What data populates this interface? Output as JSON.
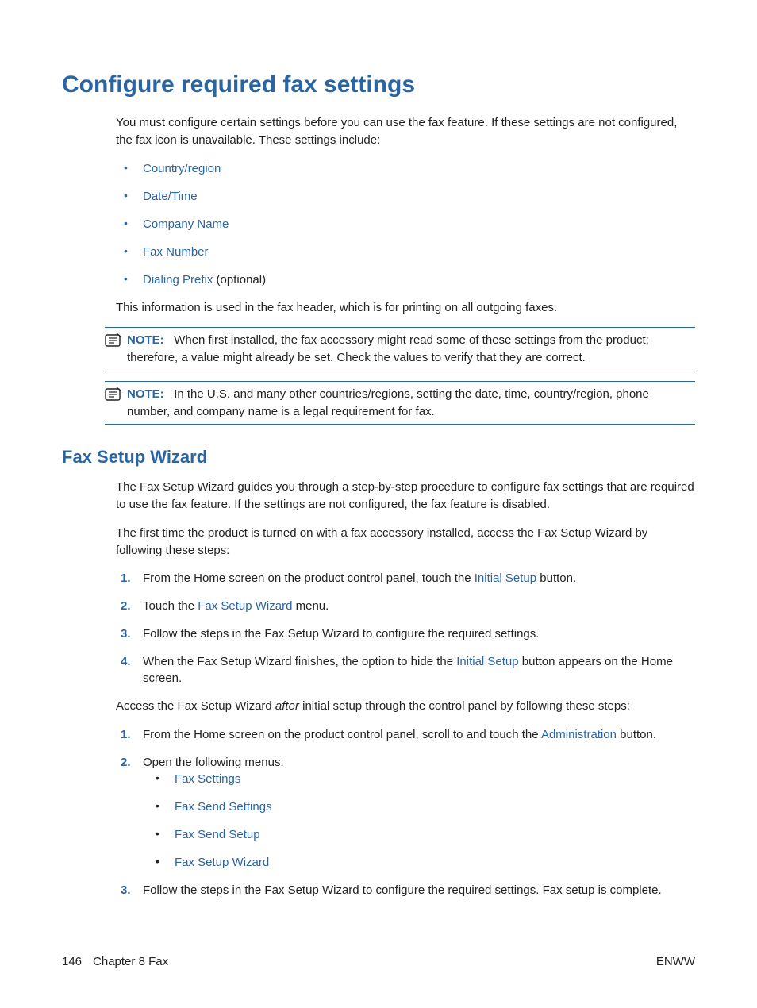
{
  "heading": "Configure required fax settings",
  "intro": "You must configure certain settings before you can use the fax feature. If these settings are not configured, the fax icon is unavailable. These settings include:",
  "settings_list": [
    "Country/region",
    "Date/Time",
    "Company Name",
    "Fax Number"
  ],
  "dialing_prefix": "Dialing Prefix",
  "dialing_suffix": " (optional)",
  "after_list": "This information is used in the fax header, which is for printing on all outgoing faxes.",
  "note1_label": "NOTE:",
  "note1_body": "When first installed, the fax accessory might read some of these settings from the product; therefore, a value might already be set. Check the values to verify that they are correct.",
  "note2_label": "NOTE:",
  "note2_body": "In the U.S. and many other countries/regions, setting the date, time, country/region, phone number, and company name is a legal requirement for fax.",
  "sub_heading": "Fax Setup Wizard",
  "fsw_para1": "The Fax Setup Wizard guides you through a step-by-step procedure to configure fax settings that are required to use the fax feature. If the settings are not configured, the fax feature is disabled.",
  "fsw_para2": "The first time the product is turned on with a fax accessory installed, access the Fax Setup Wizard by following these steps:",
  "step1_a": "From the Home screen on the product control panel, touch the ",
  "step1_link": "Initial Setup",
  "step1_b": " button.",
  "step2_a": "Touch the ",
  "step2_link": "Fax Setup Wizard",
  "step2_b": " menu.",
  "step3": "Follow the steps in the Fax Setup Wizard to configure the required settings.",
  "step4_a": "When the Fax Setup Wizard finishes, the option to hide the ",
  "step4_link": "Initial Setup",
  "step4_b": " button appears on the Home screen.",
  "after_steps_a": "Access the Fax Setup Wizard ",
  "after_steps_ital": "after",
  "after_steps_b": " initial setup through the control panel by following these steps:",
  "b_step1_a": "From the Home screen on the product control panel, scroll to and touch the ",
  "b_step1_link": "Administration",
  "b_step1_b": " button.",
  "b_step2": "Open the following menus:",
  "b_menus": [
    "Fax Settings",
    "Fax Send Settings",
    "Fax Send Setup",
    "Fax Setup Wizard"
  ],
  "b_step3": "Follow the steps in the Fax Setup Wizard to configure the required settings. Fax setup is complete.",
  "footer_page": "146",
  "footer_chapter": "Chapter 8   Fax",
  "footer_right": "ENWW"
}
